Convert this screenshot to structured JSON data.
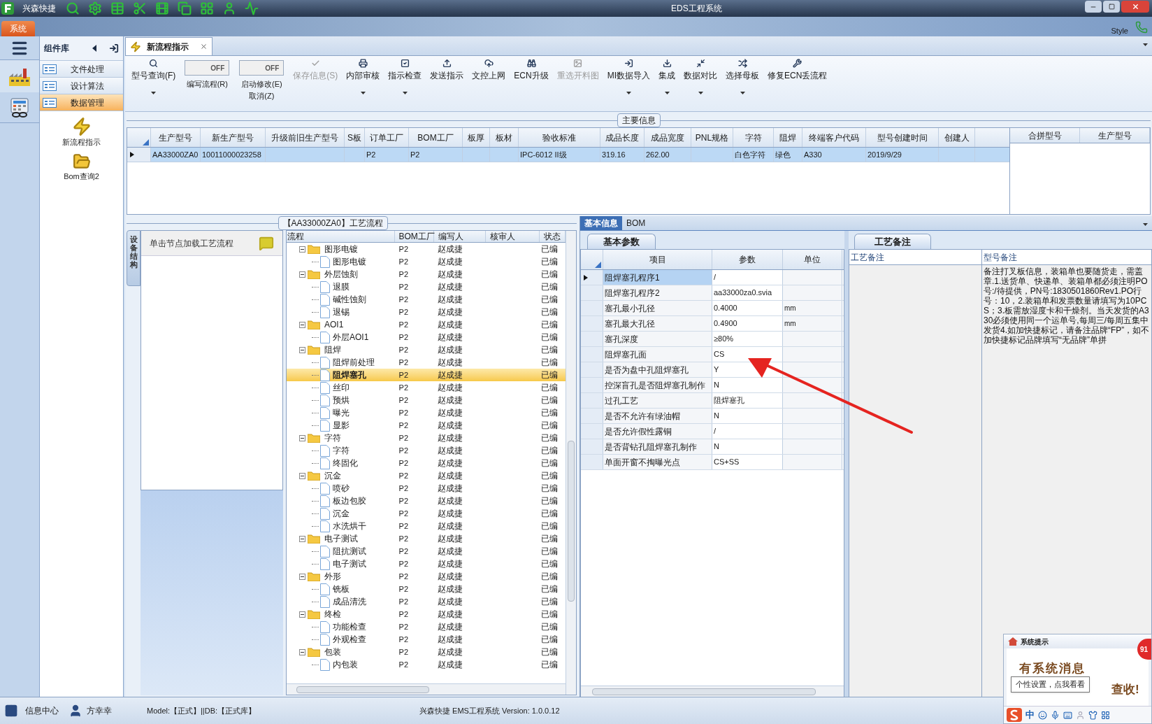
{
  "title_bar": {
    "app_name": "兴森快捷",
    "title": "EDS工程系统"
  },
  "menu": {
    "system_tab": "系统",
    "style_label": "Style"
  },
  "component_library": {
    "title": "组件库",
    "categories": [
      {
        "label": "文件处理",
        "selected": false
      },
      {
        "label": "设计算法",
        "selected": false
      },
      {
        "label": "数据管理",
        "selected": true
      }
    ],
    "tools": [
      {
        "label": "新流程指示",
        "kind": "lightning"
      },
      {
        "label": "Bom查询2",
        "kind": "folder"
      }
    ]
  },
  "document_tab": {
    "label": "新流程指示"
  },
  "toolbar": [
    {
      "kind": "button",
      "label": "型号查询(F)",
      "disabled": false,
      "dropdown": true
    },
    {
      "kind": "toggle",
      "label": "编写流程(R)",
      "on": false,
      "state_text": "OFF"
    },
    {
      "kind": "toggle",
      "label": "启动修改(E)",
      "label2": "取消(Z)",
      "on": false,
      "state_text": "OFF"
    },
    {
      "kind": "button",
      "label": "保存信息(S)",
      "disabled": true,
      "dropdown": false
    },
    {
      "kind": "button",
      "label": "内部审核",
      "disabled": false,
      "dropdown": true
    },
    {
      "kind": "button",
      "label": "指示检查",
      "disabled": false,
      "dropdown": true
    },
    {
      "kind": "button",
      "label": "发送指示",
      "disabled": false,
      "dropdown": false
    },
    {
      "kind": "button",
      "label": "文控上网",
      "disabled": false,
      "dropdown": false
    },
    {
      "kind": "button",
      "label": "ECN升级",
      "disabled": false,
      "dropdown": false
    },
    {
      "kind": "button",
      "label": "重选开料图",
      "disabled": true,
      "dropdown": false
    },
    {
      "kind": "button",
      "label": "MI数据导入",
      "disabled": false,
      "dropdown": true
    },
    {
      "kind": "button",
      "label": "集成",
      "disabled": false,
      "dropdown": true
    },
    {
      "kind": "button",
      "label": "数据对比",
      "disabled": false,
      "dropdown": true
    },
    {
      "kind": "button",
      "label": "选择母板",
      "disabled": false,
      "dropdown": true
    },
    {
      "kind": "button",
      "label": "修复ECN丢流程",
      "disabled": false,
      "dropdown": false
    }
  ],
  "main_info": {
    "title": "主要信息",
    "columns": [
      "生产型号",
      "新生产型号",
      "升级前旧生产型号",
      "S板",
      "订单工厂",
      "BOM工厂",
      "板厚",
      "板材",
      "验收标准",
      "成品长度",
      "成品宽度",
      "PNL规格",
      "字符",
      "阻焊",
      "终端客户代码",
      "型号创建时间",
      "创建人"
    ],
    "rows": [
      {
        "selected": true,
        "cells": [
          "AA33000ZA0",
          "10011000023258",
          null,
          null,
          "P2",
          "P2",
          null,
          null,
          "IPC-6012 II级",
          "319.16",
          "262.00",
          null,
          "白色字符",
          "绿色",
          "A330",
          "2019/9/29",
          null
        ]
      }
    ],
    "side_columns": [
      "合拼型号",
      "生产型号"
    ]
  },
  "process": {
    "title": "【AA33000ZA0】工艺流程",
    "side_tab": "设备结构",
    "hint": "单击节点加载工艺流程",
    "columns": [
      "流程",
      "BOM工厂",
      "编写人",
      "核审人",
      "状态"
    ],
    "tree": [
      {
        "name": "图形电镀",
        "bom": "P2",
        "writer": "赵成捷",
        "status": "已编",
        "expanded": true,
        "selected": false,
        "children": [
          {
            "name": "图形电镀",
            "bom": "P2",
            "writer": "赵成捷",
            "status": "已编",
            "selected": false
          }
        ]
      },
      {
        "name": "外层蚀刻",
        "bom": "P2",
        "writer": "赵成捷",
        "status": "已编",
        "expanded": true,
        "selected": false,
        "children": [
          {
            "name": "退膜",
            "bom": "P2",
            "writer": "赵成捷",
            "status": "已编",
            "selected": false
          },
          {
            "name": "碱性蚀刻",
            "bom": "P2",
            "writer": "赵成捷",
            "status": "已编",
            "selected": false
          },
          {
            "name": "退锡",
            "bom": "P2",
            "writer": "赵成捷",
            "status": "已编",
            "selected": false
          }
        ]
      },
      {
        "name": "AOI1",
        "bom": "P2",
        "writer": "赵成捷",
        "status": "已编",
        "expanded": true,
        "selected": false,
        "children": [
          {
            "name": "外层AOI1",
            "bom": "P2",
            "writer": "赵成捷",
            "status": "已编",
            "selected": false
          }
        ]
      },
      {
        "name": "阻焊",
        "bom": "P2",
        "writer": "赵成捷",
        "status": "已编",
        "expanded": true,
        "selected": false,
        "children": [
          {
            "name": "阻焊前处理",
            "bom": "P2",
            "writer": "赵成捷",
            "status": "已编",
            "selected": false
          },
          {
            "name": "阻焊塞孔",
            "bom": "P2",
            "writer": "赵成捷",
            "status": "已编",
            "selected": true
          },
          {
            "name": "丝印",
            "bom": "P2",
            "writer": "赵成捷",
            "status": "已编",
            "selected": false
          },
          {
            "name": "预烘",
            "bom": "P2",
            "writer": "赵成捷",
            "status": "已编",
            "selected": false
          },
          {
            "name": "曝光",
            "bom": "P2",
            "writer": "赵成捷",
            "status": "已编",
            "selected": false
          },
          {
            "name": "显影",
            "bom": "P2",
            "writer": "赵成捷",
            "status": "已编",
            "selected": false
          }
        ]
      },
      {
        "name": "字符",
        "bom": "P2",
        "writer": "赵成捷",
        "status": "已编",
        "expanded": true,
        "selected": false,
        "children": [
          {
            "name": "字符",
            "bom": "P2",
            "writer": "赵成捷",
            "status": "已编",
            "selected": false
          },
          {
            "name": "终固化",
            "bom": "P2",
            "writer": "赵成捷",
            "status": "已编",
            "selected": false
          }
        ]
      },
      {
        "name": "沉金",
        "bom": "P2",
        "writer": "赵成捷",
        "status": "已编",
        "expanded": true,
        "selected": false,
        "children": [
          {
            "name": "喷砂",
            "bom": "P2",
            "writer": "赵成捷",
            "status": "已编",
            "selected": false
          },
          {
            "name": "板边包胶",
            "bom": "P2",
            "writer": "赵成捷",
            "status": "已编",
            "selected": false
          },
          {
            "name": "沉金",
            "bom": "P2",
            "writer": "赵成捷",
            "status": "已编",
            "selected": false
          },
          {
            "name": "水洗烘干",
            "bom": "P2",
            "writer": "赵成捷",
            "status": "已编",
            "selected": false
          }
        ]
      },
      {
        "name": "电子测试",
        "bom": "P2",
        "writer": "赵成捷",
        "status": "已编",
        "expanded": true,
        "selected": false,
        "children": [
          {
            "name": "阻抗测试",
            "bom": "P2",
            "writer": "赵成捷",
            "status": "已编",
            "selected": false
          },
          {
            "name": "电子测试",
            "bom": "P2",
            "writer": "赵成捷",
            "status": "已编",
            "selected": false
          }
        ]
      },
      {
        "name": "外形",
        "bom": "P2",
        "writer": "赵成捷",
        "status": "已编",
        "expanded": true,
        "selected": false,
        "children": [
          {
            "name": "铣板",
            "bom": "P2",
            "writer": "赵成捷",
            "status": "已编",
            "selected": false
          },
          {
            "name": "成品清洗",
            "bom": "P2",
            "writer": "赵成捷",
            "status": "已编",
            "selected": false
          }
        ]
      },
      {
        "name": "终检",
        "bom": "P2",
        "writer": "赵成捷",
        "status": "已编",
        "expanded": true,
        "selected": false,
        "children": [
          {
            "name": "功能检查",
            "bom": "P2",
            "writer": "赵成捷",
            "status": "已编",
            "selected": false
          },
          {
            "name": "外观检查",
            "bom": "P2",
            "writer": "赵成捷",
            "status": "已编",
            "selected": false
          }
        ]
      },
      {
        "name": "包装",
        "bom": "P2",
        "writer": "赵成捷",
        "status": "已编",
        "expanded": true,
        "selected": false,
        "children": [
          {
            "name": "内包装",
            "bom": "P2",
            "writer": "赵成捷",
            "status": "已编",
            "selected": false
          }
        ]
      }
    ]
  },
  "detail": {
    "tabs": [
      {
        "label": "基本信息",
        "selected": true
      },
      {
        "label": "BOM",
        "selected": false
      }
    ],
    "params": {
      "tab": "基本参数",
      "columns": [
        "项目",
        "参数",
        "单位"
      ],
      "rows": [
        {
          "item": "阻焊塞孔程序1",
          "value": "/",
          "selected": true
        },
        {
          "item": "阻焊塞孔程序2",
          "value": "aa33000za0.svia",
          "selected": false
        },
        {
          "item": "塞孔最小孔径",
          "value": "0.4000",
          "unit": "mm",
          "selected": false
        },
        {
          "item": "塞孔最大孔径",
          "value": "0.4900",
          "unit": "mm",
          "selected": false
        },
        {
          "item": "塞孔深度",
          "value": "≥80%",
          "selected": false
        },
        {
          "item": "阻焊塞孔面",
          "value": "CS",
          "selected": false
        },
        {
          "item": "是否为盘中孔阻焊塞孔",
          "value": "Y",
          "selected": false
        },
        {
          "item": "控深盲孔是否阻焊塞孔制作",
          "value": "N",
          "selected": false
        },
        {
          "item": "过孔工艺",
          "value": "阻焊塞孔",
          "selected": false
        },
        {
          "item": "是否不允许有绿油帽",
          "value": "N",
          "selected": false
        },
        {
          "item": "是否允许假性露铜",
          "value": "/",
          "selected": false
        },
        {
          "item": "是否背钻孔阻焊塞孔制作",
          "value": "N",
          "selected": false
        },
        {
          "item": "单面开窗不掏曝光点",
          "value": "CS+SS",
          "selected": false
        }
      ]
    },
    "notes": {
      "tab": "工艺备注",
      "columns": [
        "工艺备注",
        "型号备注"
      ],
      "model_note": "备注打叉板信息，装箱单也要随货走，需盖章.1.送货单、快递单、装箱单都必须注明PO号:/待提供，PN号:1830501860Rev1.PO行号：10，2.装箱单和发票数量请填写为10PCS；3.板需放湿度卡和干燥剂。当天发货的A330必须使用同一个运单号,每周三/每周五集中发货4.如加快捷标记，请备注品牌“FP”，如不加快捷标记品牌填写“无品牌”单拼"
    }
  },
  "status_bar": {
    "info_center": "信息中心",
    "user": "方幸幸",
    "model_db": "Model:【正式】||DB:【正式库】",
    "version": "兴森快捷 EMS工程系统 Version: 1.0.0.12"
  },
  "notification": {
    "title": "系统提示",
    "message": "有系统消息",
    "action": "查收!",
    "badge": "91",
    "tooltip": "个性设置，点我看看",
    "ime": "中"
  }
}
